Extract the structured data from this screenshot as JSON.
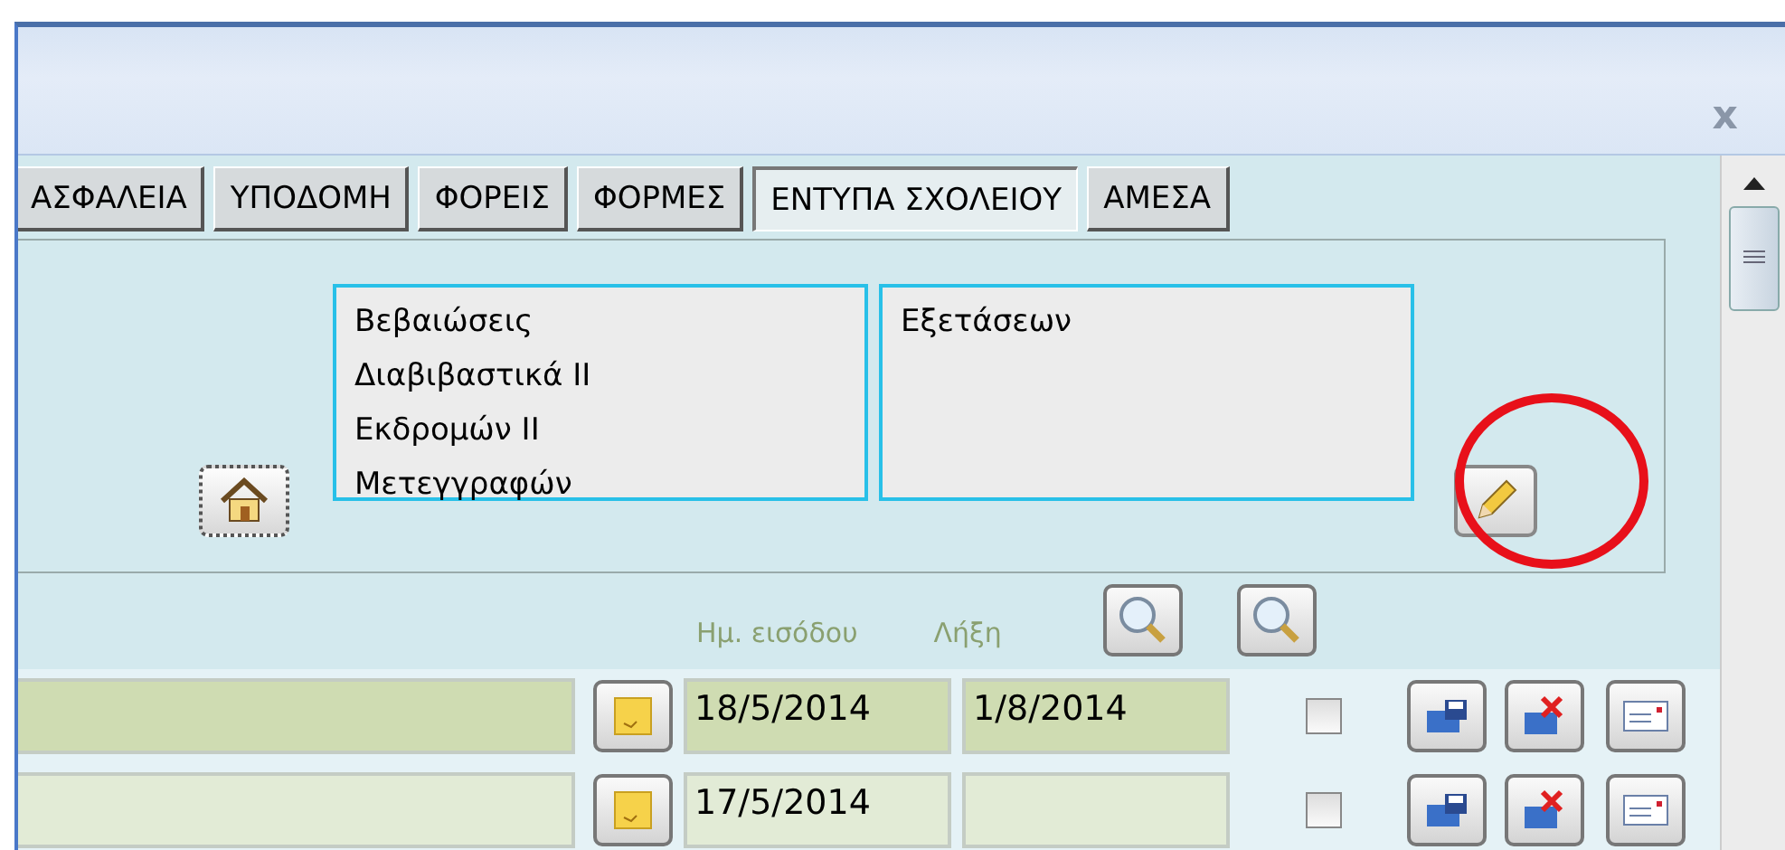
{
  "window": {
    "close": "x"
  },
  "tabs": [
    {
      "label": "ΑΣΦΑΛΕΙΑ",
      "selected": false
    },
    {
      "label": "ΥΠΟΔΟΜΗ",
      "selected": false
    },
    {
      "label": "ΦΟΡΕΙΣ",
      "selected": false
    },
    {
      "label": "ΦΟΡΜΕΣ",
      "selected": false
    },
    {
      "label": "ΕΝΤΥΠΑ ΣΧΟΛΕΙΟΥ",
      "selected": true
    },
    {
      "label": "ΑΜΕΣΑ",
      "selected": false
    }
  ],
  "lists": [
    {
      "items": [
        "Βεβαιώσεις",
        "Διαβιβαστικά ΙΙ",
        "Εκδρομών ΙΙ",
        "Μετεγγραφών"
      ]
    },
    {
      "items": [
        "Εξετάσεων"
      ]
    }
  ],
  "highlight": true,
  "columns": {
    "entry": "Ημ. εισόδου",
    "end": "Λήξη"
  },
  "rows": [
    {
      "selected": true,
      "entry": "18/5/2014",
      "end": "1/8/2014",
      "checked": false
    },
    {
      "selected": false,
      "entry": "17/5/2014",
      "checked": false
    }
  ]
}
